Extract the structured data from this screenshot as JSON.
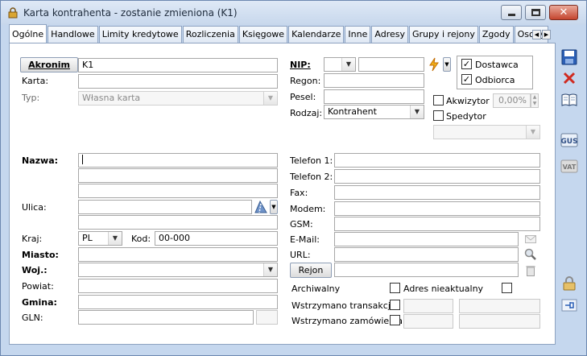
{
  "window": {
    "title": "Karta kontrahenta - zostanie zmieniona (K1)"
  },
  "tabs": [
    {
      "label": "Ogólne"
    },
    {
      "label": "Handlowe"
    },
    {
      "label": "Limity kredytowe"
    },
    {
      "label": "Rozliczenia"
    },
    {
      "label": "Księgowe"
    },
    {
      "label": "Kalendarze"
    },
    {
      "label": "Inne"
    },
    {
      "label": "Adresy"
    },
    {
      "label": "Grupy i rejony"
    },
    {
      "label": "Zgody"
    },
    {
      "label": "Osoby"
    }
  ],
  "left": {
    "akronim_label": "Akronim",
    "akronim_value": "K1",
    "karta_label": "Karta:",
    "typ_label": "Typ:",
    "typ_value": "Własna karta",
    "nazwa_label": "Nazwa:",
    "ulica_label": "Ulica:",
    "kraj_label": "Kraj:",
    "kraj_value": "PL",
    "kod_label": "Kod:",
    "kod_value": "00-000",
    "miasto_label": "Miasto:",
    "woj_label": "Woj.:",
    "powiat_label": "Powiat:",
    "gmina_label": "Gmina:",
    "gln_label": "GLN:"
  },
  "middle": {
    "nip_label": "NIP:",
    "regon_label": "Regon:",
    "pesel_label": "Pesel:",
    "rodzaj_label": "Rodzaj:",
    "rodzaj_value": "Kontrahent",
    "telefon1_label": "Telefon 1:",
    "telefon2_label": "Telefon 2:",
    "fax_label": "Fax:",
    "modem_label": "Modem:",
    "gsm_label": "GSM:",
    "email_label": "E-Mail:",
    "url_label": "URL:",
    "rejon_button": "Rejon",
    "archiwalny_label": "Archiwalny",
    "adres_nieaktualny_label": "Adres nieaktualny",
    "wstrzymano_transakcje_label": "Wstrzymano transakcje",
    "wstrzymano_zamowienia_label": "Wstrzymano zamówienia"
  },
  "right": {
    "dostawca_label": "Dostawca",
    "dostawca_checked": "✓",
    "odbiorca_label": "Odbiorca",
    "odbiorca_checked": "✓",
    "akwizytor_label": "Akwizytor",
    "akwizytor_percent": "0,00%",
    "spedytor_label": "Spedytor"
  },
  "side_toolbar": [
    "save-icon",
    "delete-icon",
    "book-icon",
    "gus-icon",
    "vat-icon",
    "lock-icon",
    "pin-icon"
  ],
  "colors": {
    "frame": "#c5d7ee",
    "accent": "#1a5fb4",
    "close": "#c5452f"
  }
}
